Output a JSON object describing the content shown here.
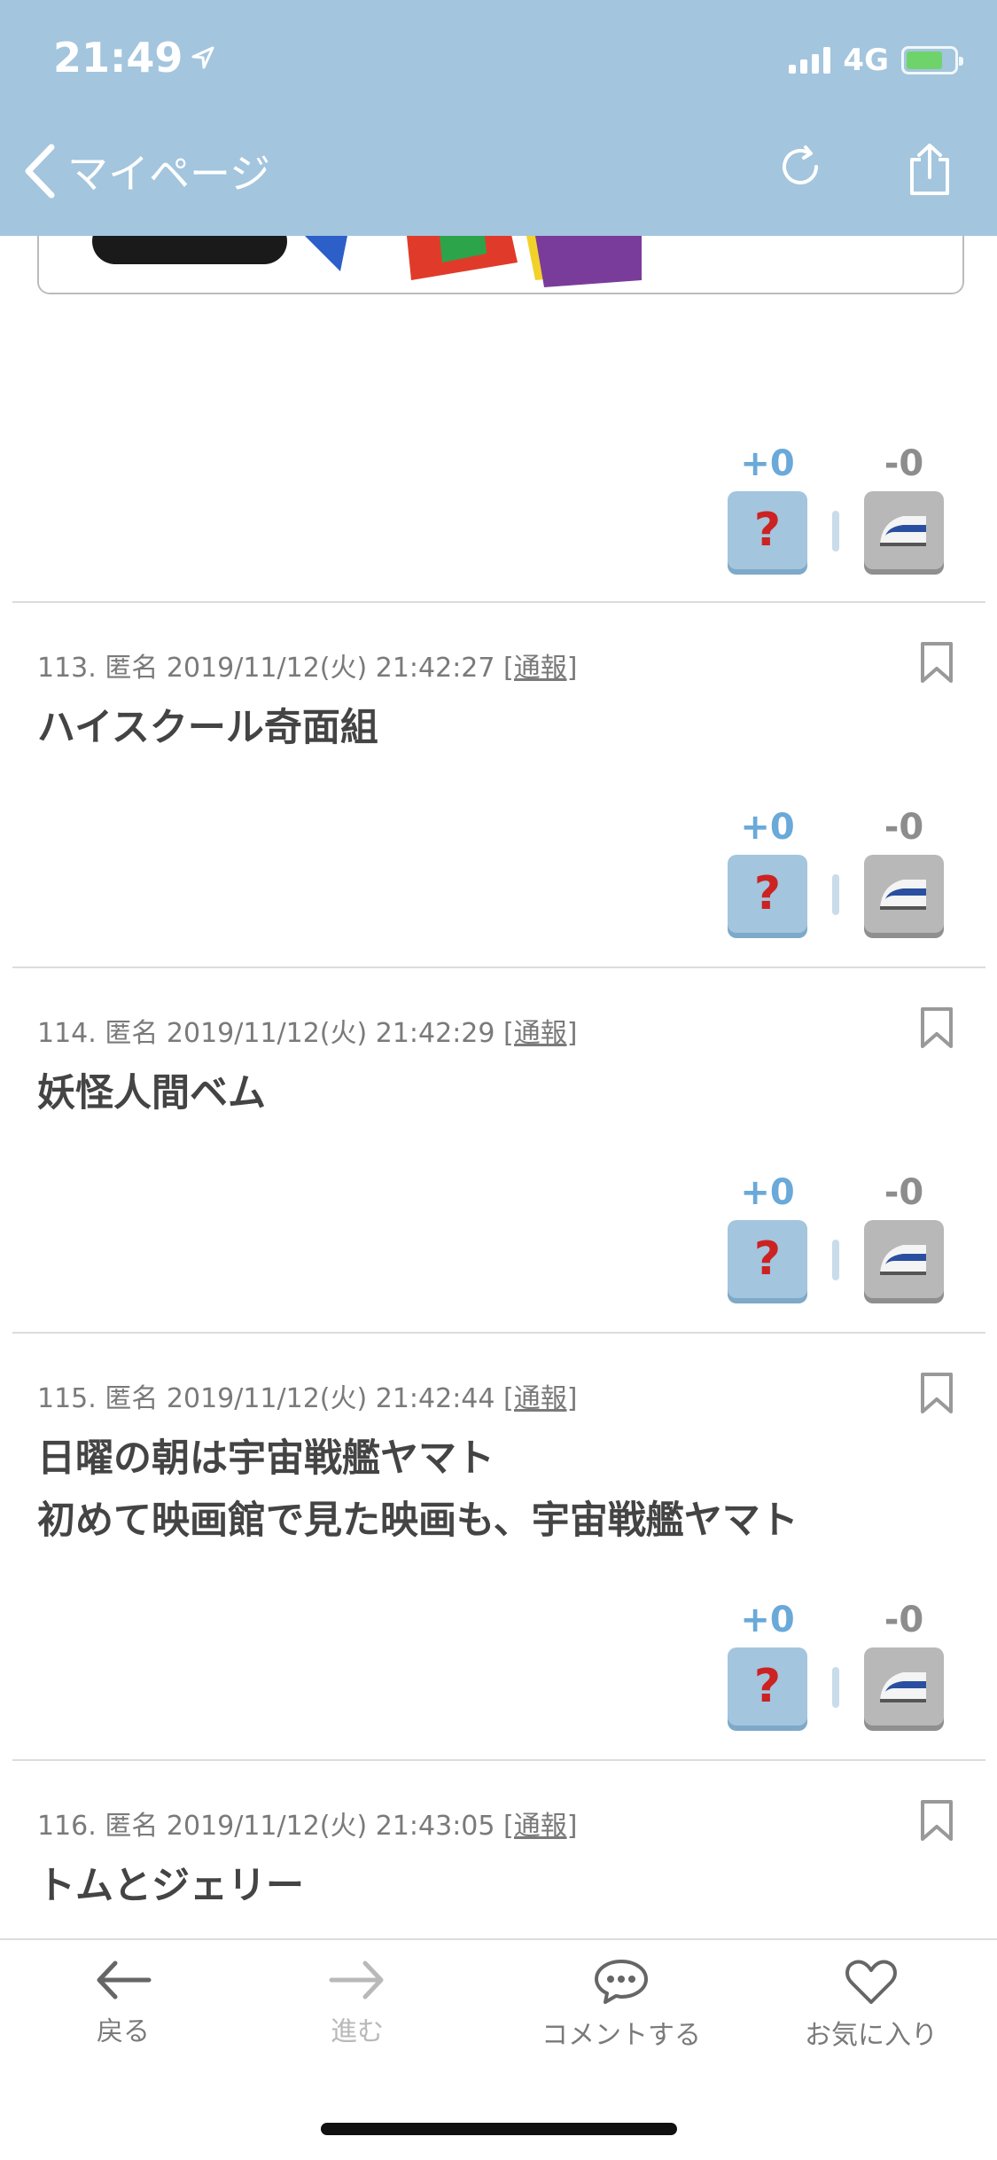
{
  "status_bar": {
    "time": "21:49",
    "network": "4G"
  },
  "nav": {
    "back_label": "マイページ"
  },
  "top_votes": {
    "plus": "+0",
    "minus": "-0"
  },
  "posts": [
    {
      "number": "113.",
      "author": "匿名",
      "datetime": "2019/11/12(火) 21:42:27",
      "report": "[通報]",
      "lines": [
        "ハイスクール奇面組"
      ],
      "plus": "+0",
      "minus": "-0"
    },
    {
      "number": "114.",
      "author": "匿名",
      "datetime": "2019/11/12(火) 21:42:29",
      "report": "[通報]",
      "lines": [
        "妖怪人間ベム"
      ],
      "plus": "+0",
      "minus": "-0"
    },
    {
      "number": "115.",
      "author": "匿名",
      "datetime": "2019/11/12(火) 21:42:44",
      "report": "[通報]",
      "lines": [
        "日曜の朝は宇宙戦艦ヤマト",
        "初めて映画館で見た映画も、宇宙戦艦ヤマト"
      ],
      "plus": "+0",
      "minus": "-0"
    },
    {
      "number": "116.",
      "author": "匿名",
      "datetime": "2019/11/12(火) 21:43:05",
      "report": "[通報]",
      "lines": [
        "トムとジェリー"
      ],
      "plus": "+0",
      "minus": "-0"
    }
  ],
  "toolbar": {
    "back_label": "戻る",
    "forward_label": "進む",
    "comment_label": "コメントする",
    "favorite_label": "お気に入り"
  },
  "icons": {
    "plus_vote": "question-mark-icon",
    "minus_vote": "bullet-train-icon",
    "bookmark": "bookmark-icon"
  },
  "colors": {
    "header": "#a3c5de",
    "plus": "#6aa9d8",
    "minus": "#8d8d8d"
  }
}
